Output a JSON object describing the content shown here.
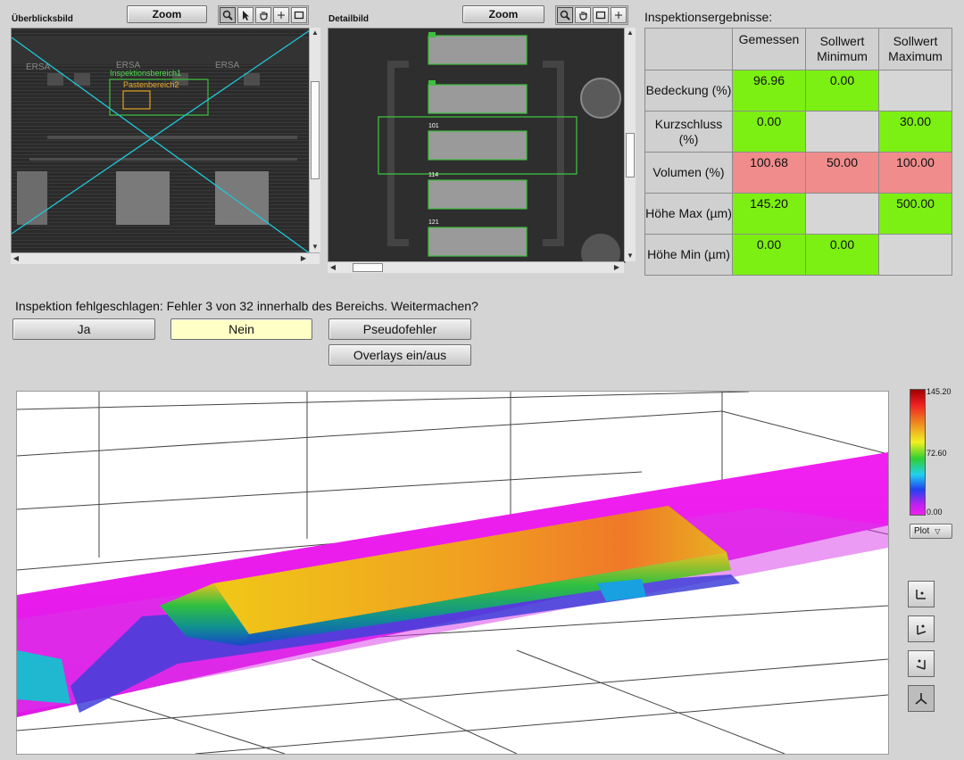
{
  "overview": {
    "label": "Überblicksbild",
    "zoom_label": "Zoom",
    "tools": [
      "zoom-icon",
      "pointer-icon",
      "pan-hand-icon",
      "crosshair-icon",
      "rectangle-icon"
    ],
    "overlay_inspection": "Inspektionsbereich1",
    "overlay_paste": "Pastenbereich2",
    "board_marks": [
      "ERSA",
      "ERSA",
      "ERSA"
    ]
  },
  "detail": {
    "label": "Detailbild",
    "zoom_label": "Zoom",
    "tools": [
      "zoom-icon",
      "pan-hand-icon",
      "rectangle-icon",
      "crosshair-icon"
    ],
    "pad_labels": [
      "101",
      "114",
      "121"
    ]
  },
  "results": {
    "title": "Inspektionsergebnisse:",
    "columns": [
      "Gemessen",
      "Sollwert Minimum",
      "Sollwert Maximum"
    ],
    "rows": [
      {
        "label": "Bedeckung (%)",
        "gemessen": "96.96",
        "min": "0.00",
        "max": "",
        "colors": [
          "green",
          "green",
          "grey"
        ]
      },
      {
        "label": "Kurzschluss (%)",
        "gemessen": "0.00",
        "min": "",
        "max": "30.00",
        "colors": [
          "green",
          "grey",
          "green"
        ]
      },
      {
        "label": "Volumen (%)",
        "gemessen": "100.68",
        "min": "50.00",
        "max": "100.00",
        "colors": [
          "red",
          "red",
          "red"
        ]
      },
      {
        "label": "Höhe Max (µm)",
        "gemessen": "145.20",
        "min": "",
        "max": "500.00",
        "colors": [
          "green",
          "grey",
          "green"
        ]
      },
      {
        "label": "Höhe Min (µm)",
        "gemessen": "0.00",
        "min": "0.00",
        "max": "",
        "colors": [
          "green",
          "green",
          "grey"
        ]
      }
    ]
  },
  "message": "Inspektion fehlgeschlagen: Fehler 3 von 32 innerhalb des Bereichs. Weitermachen?",
  "buttons": {
    "ja": "Ja",
    "nein": "Nein",
    "pseudofehler": "Pseudofehler",
    "overlays": "Overlays ein/aus"
  },
  "colorbar": {
    "ticks": [
      "145.20",
      "72.60",
      "0.00"
    ],
    "plot_label": "Plot"
  },
  "colors": {
    "green": "#7cf012",
    "red": "#f08c8c",
    "grey": "#d6d6d6",
    "nein_highlight": "#ffffc6",
    "magenta": "#f020f0",
    "overlay_cyan": "#20c8d8"
  }
}
